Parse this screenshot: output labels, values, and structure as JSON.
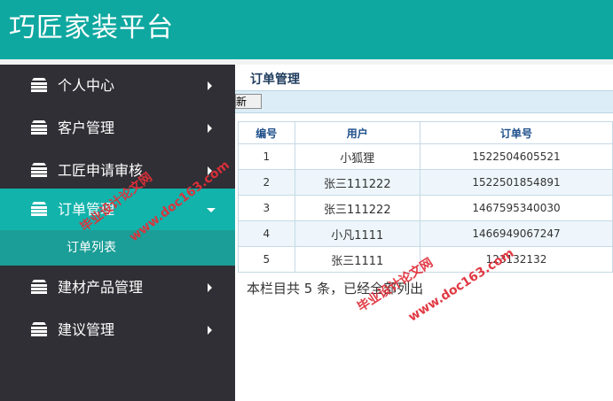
{
  "header": {
    "title": "巧匠家装平台"
  },
  "sidebar": {
    "items": [
      {
        "label": "个人中心",
        "icon": "layers-icon"
      },
      {
        "label": "客户管理",
        "icon": "layers-icon"
      },
      {
        "label": "工匠申请审核",
        "icon": "layers-icon"
      },
      {
        "label": "订单管理",
        "icon": "layers-icon",
        "expanded": true
      },
      {
        "label": "建材产品管理",
        "icon": "layers-icon"
      },
      {
        "label": "建议管理",
        "icon": "layers-icon"
      }
    ],
    "subitem": {
      "label": "订单列表"
    }
  },
  "main": {
    "page_title": "订单管理",
    "refresh_label": "刷新",
    "table": {
      "headers": [
        "编号",
        "用户",
        "订单号"
      ],
      "rows": [
        [
          "1",
          "小狐狸",
          "1522504605521"
        ],
        [
          "2",
          "张三111222",
          "1522501854891"
        ],
        [
          "3",
          "张三111222",
          "1467595340030"
        ],
        [
          "4",
          "小凡1111",
          "1466949067247"
        ],
        [
          "5",
          "张三1111",
          "123132132"
        ]
      ]
    },
    "summary": "本栏目共 5 条，已经全部列出"
  },
  "watermarks": {
    "text_cn": "毕业设计论文网",
    "text_url": "www.doc163.com"
  },
  "colors": {
    "header_bg": "#0fa8a0",
    "sidebar_bg": "#2f2f35",
    "active_bg": "#12b3ab",
    "sub_bg": "#1b9e97",
    "watermark": "#e0303a"
  }
}
